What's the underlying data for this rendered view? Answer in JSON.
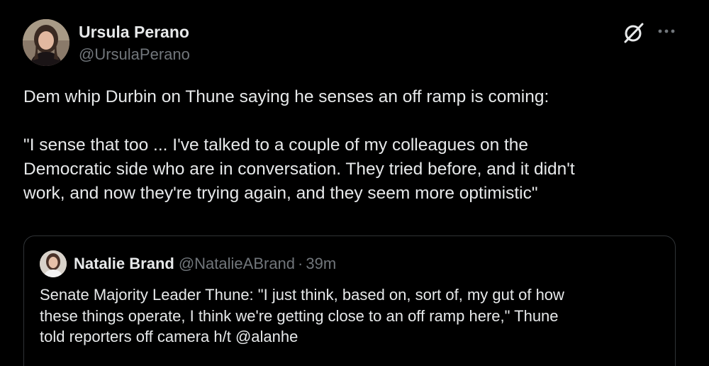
{
  "author": {
    "name": "Ursula Perano",
    "handle": "@UrsulaPerano"
  },
  "icons": {
    "grok": "grok-icon",
    "more": "more-horizontal-icon"
  },
  "tweet": {
    "text": "Dem whip Durbin on Thune saying he senses an off ramp is coming:\n\n\"I sense that too ... I've talked to a couple of my colleagues on the\nDemocratic side who are in conversation. They tried before, and it didn't\nwork, and now they're trying again, and they seem more optimistic\""
  },
  "quote": {
    "name": "Natalie Brand",
    "handle": "@NatalieABrand",
    "separator": "·",
    "time": "39m",
    "text": "Senate Majority Leader Thune: \"I just think, based on, sort of, my gut of how\nthese things operate, I think we're getting close to an off ramp here,\" Thune\ntold reporters off camera h/t @alanhe"
  },
  "colors": {
    "background": "#000000",
    "text_primary": "#e7e9ea",
    "text_secondary": "#71767b",
    "border": "#2f3336"
  }
}
